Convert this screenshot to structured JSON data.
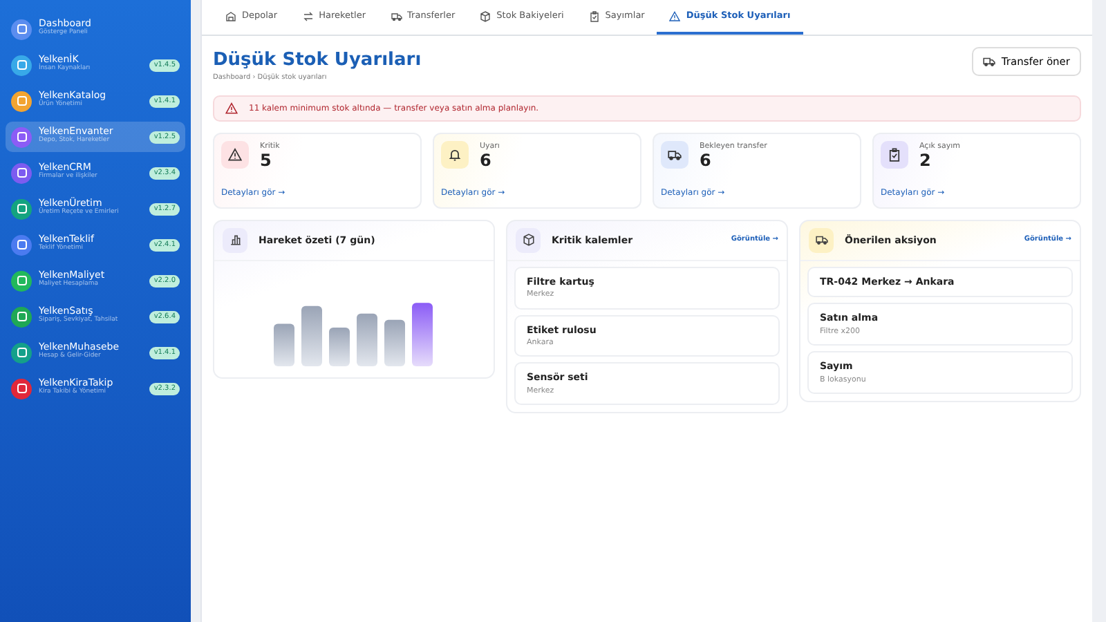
{
  "sidebar": {
    "items": [
      {
        "title": "Dashboard",
        "subtitle": "Gösterge Paneli",
        "color": "#5b8def",
        "selected": false
      },
      {
        "title": "YelkenİK",
        "subtitle": "İnsan Kaynakları",
        "version": "v1.4.5",
        "color": "#38a9e8",
        "selected": false
      },
      {
        "title": "YelkenKatalog",
        "subtitle": "Ürün Yönetimi",
        "version": "v1.4.1",
        "color": "#f2a431",
        "selected": false
      },
      {
        "title": "YelkenEnvanter",
        "subtitle": "Depo, Stok, Hareketler",
        "version": "v1.2.5",
        "color": "#8b5cf6",
        "selected": true
      },
      {
        "title": "YelkenCRM",
        "subtitle": "Firmalar ve ilişkiler",
        "version": "v2.3.4",
        "color": "#7c5cf0",
        "selected": false
      },
      {
        "title": "YelkenÜretim",
        "subtitle": "Üretim Reçete ve Emirleri",
        "version": "v1.2.7",
        "color": "#14a37f",
        "selected": false
      },
      {
        "title": "YelkenTeklif",
        "subtitle": "Teklif Yönetimi",
        "version": "v2.4.1",
        "color": "#4b7bf0",
        "selected": false
      },
      {
        "title": "YelkenMaliyet",
        "subtitle": "Maliyet Hesaplama",
        "version": "v2.2.0",
        "color": "#22b85c",
        "selected": false
      },
      {
        "title": "YelkenSatış",
        "subtitle": "Sipariş, Sevkiyat, Tahsilat",
        "version": "v2.6.4",
        "color": "#1fa855",
        "selected": false
      },
      {
        "title": "YelkenMuhasebe",
        "subtitle": "Hesap & Gelir-Gider",
        "version": "v1.4.1",
        "color": "#14a08a",
        "selected": false
      },
      {
        "title": "YelkenKiraTakip",
        "subtitle": "Kira Takibi & Yönetimi",
        "version": "v2.3.2",
        "color": "#e0283a",
        "selected": false
      }
    ]
  },
  "tabs": [
    {
      "label": "Depolar",
      "selected": false
    },
    {
      "label": "Hareketler",
      "selected": false
    },
    {
      "label": "Transferler",
      "selected": false
    },
    {
      "label": "Stok Bakiyeleri",
      "selected": false
    },
    {
      "label": "Sayımlar",
      "selected": false
    },
    {
      "label": "Düşük Stok Uyarıları",
      "selected": true
    }
  ],
  "page": {
    "title": "Düşük Stok Uyarıları",
    "breadcrumb": "Dashboard › Düşük stok uyarıları",
    "action": "Transfer öner"
  },
  "alert": "11 kalem minimum stok altında — transfer veya satın alma planlayın.",
  "stats": [
    {
      "label": "Kritik",
      "value": "5",
      "color": "#fde2e4",
      "link": "Detayları gör →"
    },
    {
      "label": "Uyarı",
      "value": "6",
      "color": "#fdf1c4",
      "link": "Detayları gör →"
    },
    {
      "label": "Bekleyen transfer",
      "value": "6",
      "color": "#dfe8fb",
      "link": "Detayları gör →"
    },
    {
      "label": "Açık sayım",
      "value": "2",
      "color": "#e4e0fb",
      "link": "Detayları gör →"
    }
  ],
  "panels": [
    {
      "kind": "chart",
      "title": "Hareket özeti (7 gün)",
      "color": "#ecebfb"
    },
    {
      "kind": "list",
      "title": "Kritik kalemler",
      "color": "#ecebfb",
      "link": "Görüntüle →",
      "items": [
        {
          "title": "Filtre kartuş",
          "subtitle": "Merkez"
        },
        {
          "title": "Etiket rulosu",
          "subtitle": "Ankara"
        },
        {
          "title": "Sensör seti",
          "subtitle": "Merkez"
        }
      ]
    },
    {
      "kind": "list",
      "title": "Önerilen aksiyon",
      "color": "#fdf1c4",
      "link": "Görüntüle →",
      "items": [
        {
          "title": "TR-042 Merkez → Ankara"
        },
        {
          "title": "Satın alma",
          "subtitle": "Filtre x200"
        },
        {
          "title": "Sayım",
          "subtitle": "B lokasyonu"
        }
      ]
    }
  ]
}
